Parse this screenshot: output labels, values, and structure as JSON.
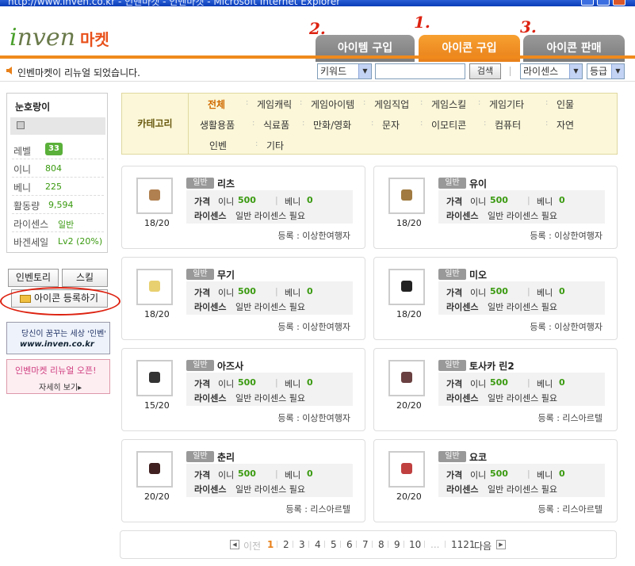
{
  "window_title": "http://www.inven.co.kr - 인벤마켓 - 인벤마켓 - Microsoft Internet Explorer",
  "logo": {
    "brand": "nven",
    "brand_initial": "i",
    "market": "마켓"
  },
  "tabs": [
    "아이템 구입",
    "아이콘 구입",
    "아이콘 판매"
  ],
  "annotations": [
    "2.",
    "1.",
    "3."
  ],
  "notice": "인벤마켓이 리뉴얼 되었습니다.",
  "search": {
    "keyword_select": "키워드",
    "query": "",
    "button": "검색",
    "license_select": "라이센스",
    "grade_select": "등급"
  },
  "profile": {
    "name": "눈호랑이",
    "level_label": "레벨",
    "level": "33",
    "stats": [
      {
        "label": "이니",
        "value": "804"
      },
      {
        "label": "베니",
        "value": "225"
      },
      {
        "label": "활동량",
        "value": "9,594"
      },
      {
        "label": "라이센스",
        "value": "일반"
      },
      {
        "label": "바겐세일",
        "value": "Lv2 (20%)"
      }
    ]
  },
  "side_buttons": {
    "inventory": "인벤토리",
    "skill": "스킬",
    "register": "아이콘 등록하기"
  },
  "banners": {
    "inven_slogan": "당신이 꿈꾸는 세상 '인벤'",
    "inven_url": "www.inven.co.kr",
    "renewal": "인벤마켓 리뉴얼 오픈!",
    "renewal_more": "자세히 보기▸"
  },
  "category": {
    "label": "카테고리",
    "items": [
      "전체",
      "게임캐릭",
      "게임아이템",
      "게임직업",
      "게임스킬",
      "게임기타",
      "인물",
      "생활용품",
      "식료품",
      "만화/영화",
      "문자",
      "이모티콘",
      "컴퓨터",
      "자연",
      "인벤",
      "기타"
    ]
  },
  "card_labels": {
    "badge": "일반",
    "price": "가격",
    "ini": "이니",
    "beni": "베니",
    "license": "라이센스",
    "license_req": "일반 라이센스 필요"
  },
  "products": [
    {
      "name": "리츠",
      "stock": "18/20",
      "ini": "500",
      "beni": "0",
      "seller": "등록 : 이상한여행자",
      "color": "#b08050"
    },
    {
      "name": "유이",
      "stock": "18/20",
      "ini": "500",
      "beni": "0",
      "seller": "등록 : 이상한여행자",
      "color": "#a07a40"
    },
    {
      "name": "무기",
      "stock": "18/20",
      "ini": "500",
      "beni": "0",
      "seller": "등록 : 이상한여행자",
      "color": "#e8d070"
    },
    {
      "name": "미오",
      "stock": "18/20",
      "ini": "500",
      "beni": "0",
      "seller": "등록 : 이상한여행자",
      "color": "#222222"
    },
    {
      "name": "아즈사",
      "stock": "15/20",
      "ini": "500",
      "beni": "0",
      "seller": "등록 : 이상한여행자",
      "color": "#333333"
    },
    {
      "name": "토사카 린2",
      "stock": "20/20",
      "ini": "500",
      "beni": "0",
      "seller": "등록 : 리스아르텔",
      "color": "#6a4040"
    },
    {
      "name": "춘리",
      "stock": "20/20",
      "ini": "500",
      "beni": "0",
      "seller": "등록 : 리스아르텔",
      "color": "#402020"
    },
    {
      "name": "요코",
      "stock": "20/20",
      "ini": "500",
      "beni": "0",
      "seller": "등록 : 리스아르텔",
      "color": "#c04040"
    }
  ],
  "pager": {
    "prev": "이전",
    "pages": [
      "1",
      "2",
      "3",
      "4",
      "5",
      "6",
      "7",
      "8",
      "9",
      "10"
    ],
    "ellipsis": "...",
    "last": "1121",
    "next": "다음"
  },
  "colors": {
    "accent": "#f08a1c",
    "green": "#3a9a10",
    "annotation_red": "#dd2211"
  }
}
